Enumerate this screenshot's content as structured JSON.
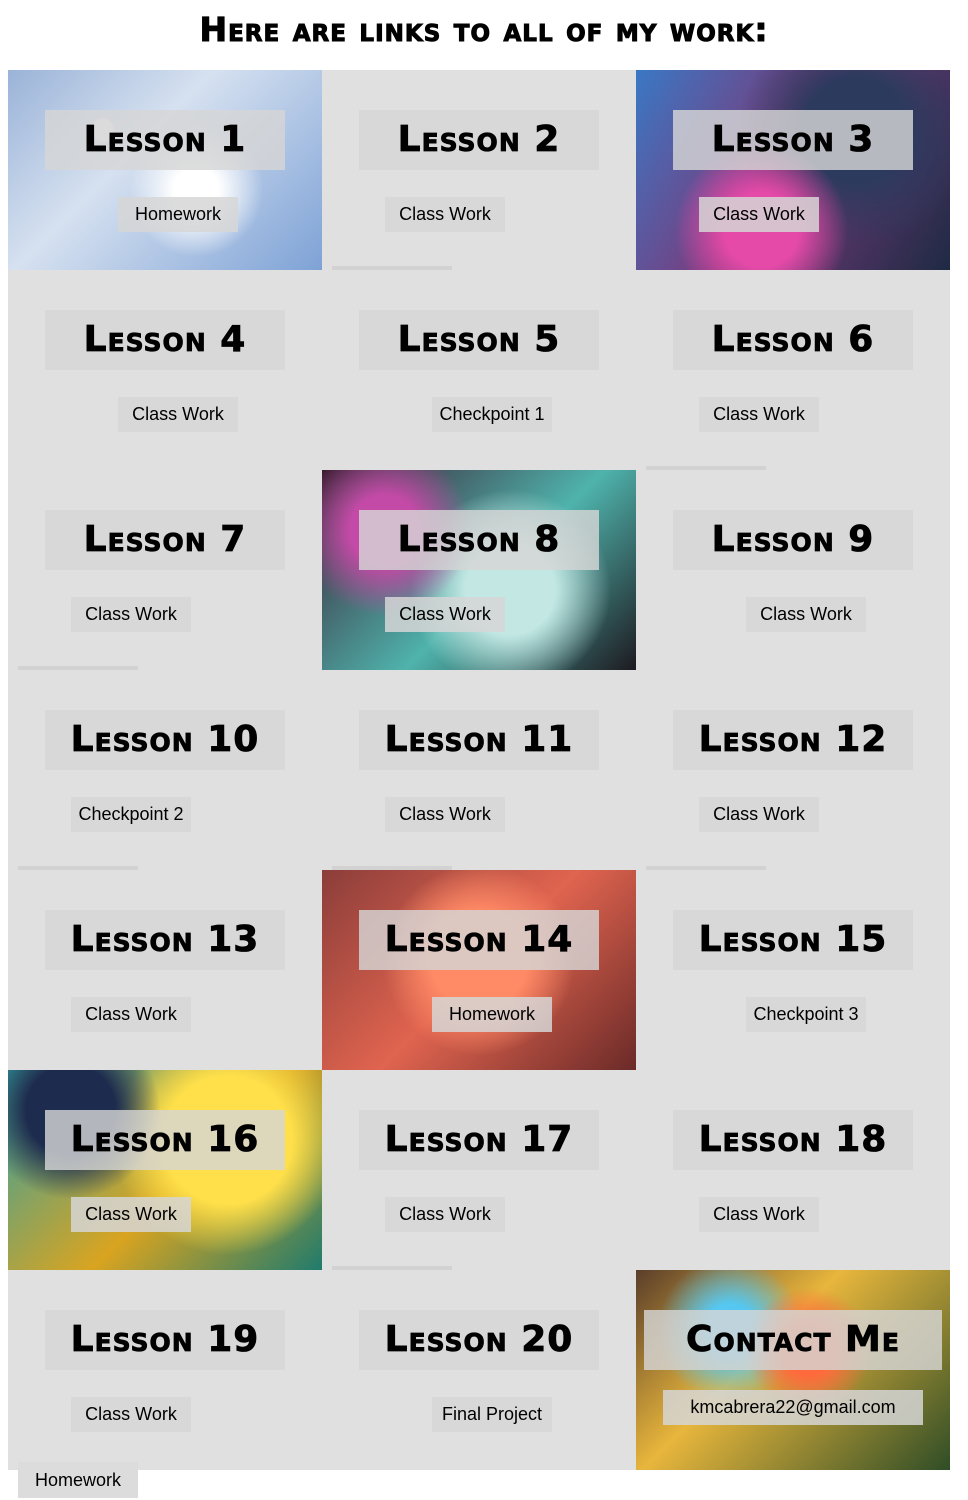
{
  "page_title": "Here are links to all of my work:",
  "lessons": [
    {
      "title": "Lesson 1",
      "link": "Homework"
    },
    {
      "title": "Lesson 2",
      "link": "Class Work"
    },
    {
      "title": "Lesson 3",
      "link": "Class Work"
    },
    {
      "title": "Lesson 4",
      "link": "Class Work"
    },
    {
      "title": "Lesson 5",
      "link": "Checkpoint 1"
    },
    {
      "title": "Lesson 6",
      "link": "Class Work"
    },
    {
      "title": "Lesson 7",
      "link": "Class Work"
    },
    {
      "title": "Lesson 8",
      "link": "Class Work"
    },
    {
      "title": "Lesson 9",
      "link": "Class Work"
    },
    {
      "title": "Lesson 10",
      "link": "Checkpoint 2"
    },
    {
      "title": "Lesson 11",
      "link": "Class Work"
    },
    {
      "title": "Lesson 12",
      "link": "Class Work"
    },
    {
      "title": "Lesson 13",
      "link": "Class Work"
    },
    {
      "title": "Lesson 14",
      "link": "Homework"
    },
    {
      "title": "Lesson 15",
      "link": "Checkpoint 3"
    },
    {
      "title": "Lesson 16",
      "link": "Class Work"
    },
    {
      "title": "Lesson 17",
      "link": "Class Work"
    },
    {
      "title": "Lesson 18",
      "link": "Class Work"
    },
    {
      "title": "Lesson 19",
      "link": "Class Work"
    },
    {
      "title": "Lesson 20",
      "link": "Final Project"
    }
  ],
  "contact": {
    "title": "Contact Me",
    "email": "kmcabrera22@gmail.com"
  },
  "stray_link": "Homework"
}
